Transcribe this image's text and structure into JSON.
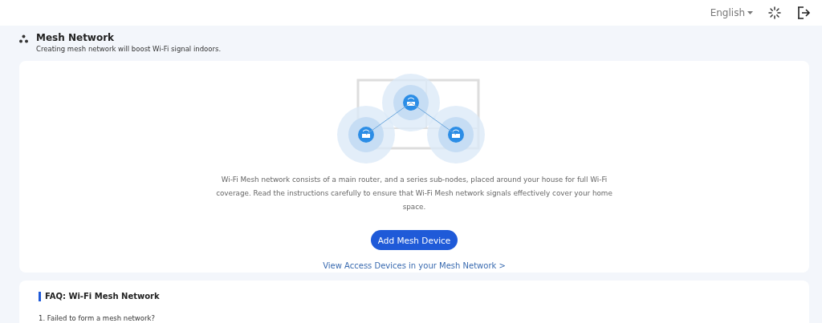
{
  "header": {
    "language": "English"
  },
  "page": {
    "title": "Mesh Network",
    "subtitle": "Creating mesh network will boost Wi-Fi signal indoors."
  },
  "intro": {
    "description": "Wi-Fi Mesh network consists of a main router, and a series sub-nodes, placed around your house for full Wi-Fi coverage. Read the instructions carefully to ensure that Wi-Fi Mesh network signals effectively cover your home space.",
    "button": "Add Mesh Device",
    "link": "View Access Devices in your Mesh Network >"
  },
  "faq": {
    "title": "FAQ: Wi-Fi Mesh Network",
    "items": [
      "1. Failed to form a mesh network?"
    ]
  }
}
